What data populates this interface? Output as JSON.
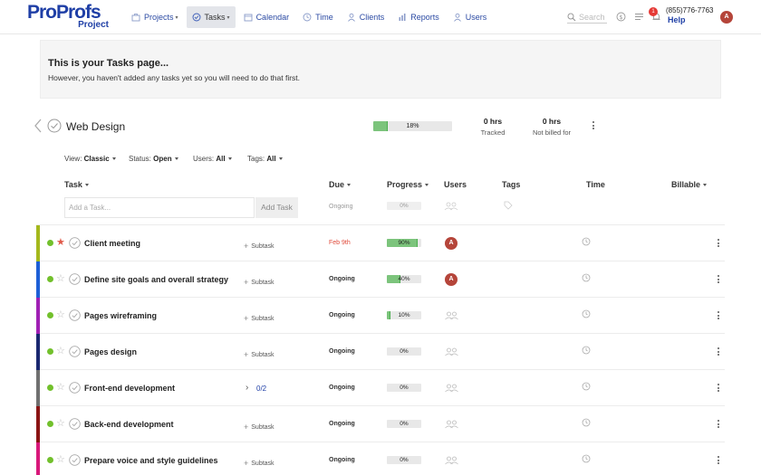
{
  "header": {
    "logo_main": "ProProfs",
    "logo_sub": "Project",
    "nav": [
      {
        "label": "Projects",
        "icon": "briefcase-icon",
        "dropdown": true
      },
      {
        "label": "Tasks",
        "icon": "check-circle-icon",
        "dropdown": true,
        "active": true
      },
      {
        "label": "Calendar",
        "icon": "calendar-icon"
      },
      {
        "label": "Time",
        "icon": "clock-icon"
      },
      {
        "label": "Clients",
        "icon": "clients-icon"
      },
      {
        "label": "Reports",
        "icon": "bar-chart-icon"
      },
      {
        "label": "Users",
        "icon": "user-icon"
      }
    ],
    "search_placeholder": "Search",
    "notification_count": "1",
    "phone": "(855)776-7763",
    "help": "Help",
    "avatar_initial": "A"
  },
  "banner": {
    "title": "This is your Tasks page...",
    "text": "However, you haven't added any tasks yet so you will need to do that first."
  },
  "project": {
    "title": "Web Design",
    "progress_percent": 18,
    "progress_label": "18%",
    "tracked_value": "0 hrs",
    "tracked_label": "Tracked",
    "notbilled_value": "0 hrs",
    "notbilled_label": "Not billed for"
  },
  "filters": {
    "view_label": "View:",
    "view_value": "Classic",
    "status_label": "Status:",
    "status_value": "Open",
    "users_label": "Users:",
    "users_value": "All",
    "tags_label": "Tags:",
    "tags_value": "All"
  },
  "columns": {
    "task": "Task",
    "due": "Due",
    "progress": "Progress",
    "users": "Users",
    "tags": "Tags",
    "time": "Time",
    "billable": "Billable"
  },
  "add_task": {
    "placeholder": "Add a Task...",
    "button": "Add Task",
    "due": "Ongoing",
    "progress_label": "0%"
  },
  "tasks": [
    {
      "name": "Client meeting",
      "stripe": "#a4b81c",
      "starred": true,
      "subtask": "Subtask",
      "due": "Feb 9th",
      "late": true,
      "progress": 90,
      "progress_label": "90%",
      "avatar": "A"
    },
    {
      "name": "Define site goals and overall strategy",
      "stripe": "#1e5fd6",
      "starred": false,
      "subtask": "Subtask",
      "due": "Ongoing",
      "progress": 40,
      "progress_label": "40%",
      "avatar": "A"
    },
    {
      "name": "Pages wireframing",
      "stripe": "#a020b4",
      "starred": false,
      "subtask": "Subtask",
      "due": "Ongoing",
      "progress": 10,
      "progress_label": "10%"
    },
    {
      "name": "Pages design",
      "stripe": "#1a2870",
      "starred": false,
      "subtask": "Subtask",
      "due": "Ongoing",
      "progress": 0,
      "progress_label": "0%"
    },
    {
      "name": "Front-end development",
      "stripe": "#707070",
      "starred": false,
      "subcount": "0/2",
      "due": "Ongoing",
      "progress": 0,
      "progress_label": "0%"
    },
    {
      "name": "Back-end development",
      "stripe": "#8a1414",
      "starred": false,
      "subtask": "Subtask",
      "due": "Ongoing",
      "progress": 0,
      "progress_label": "0%"
    },
    {
      "name": "Prepare voice and style guidelines",
      "stripe": "#d8187a",
      "starred": false,
      "subtask": "Subtask",
      "due": "Ongoing",
      "progress": 0,
      "progress_label": "0%"
    }
  ]
}
